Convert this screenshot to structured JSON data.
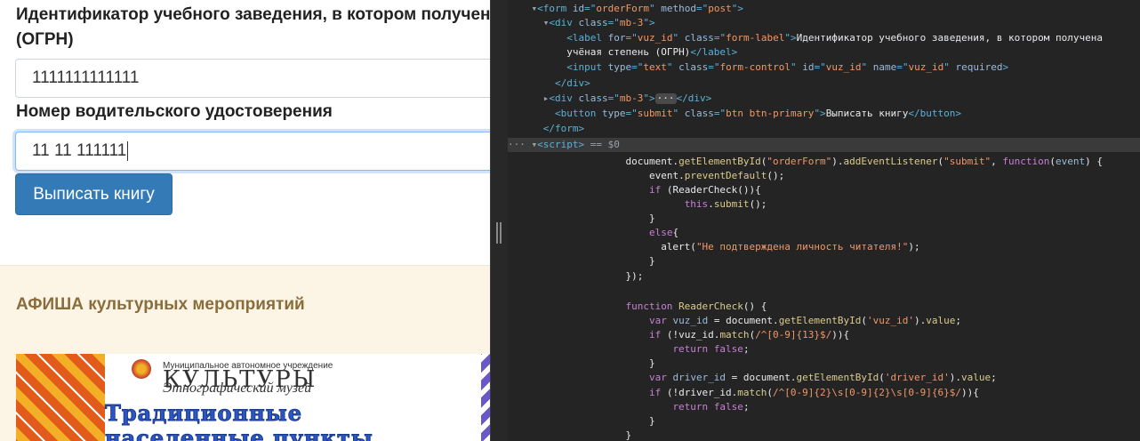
{
  "page": {
    "label_vuz": "Идентификатор учебного заведения, в котором получена учёная степень",
    "label_vuz_suffix": "(ОГРН)",
    "input_vuz_value": "1111111111111",
    "label_driver": "Номер водительского удостоверения",
    "input_driver_value": "11 11 111111",
    "submit_label": "Выписать книгу",
    "afisha_title": "АФИША культурных мероприятий",
    "poster": {
      "small": "Муниципальное автономное учреждение",
      "big": "КУЛЬТУРЫ",
      "italic": "Этнографический музей",
      "head1": "Традиционные",
      "head2": "населенные пункты"
    }
  },
  "devtools": {
    "lines": [
      {
        "html": "    <span class='tri'>▾</span><span class='tag'>&lt;form</span> <span class='an'>id</span><span class='tag'>=\"</span><span class='av'>orderForm</span><span class='tag'>\"</span> <span class='an'>method</span><span class='tag'>=\"</span><span class='av'>post</span><span class='tag'>\"&gt;</span>"
      },
      {
        "html": "      <span class='tri'>▾</span><span class='tag'>&lt;div</span> <span class='an'>class</span><span class='tag'>=\"</span><span class='av'>mb-3</span><span class='tag'>\"&gt;</span>"
      },
      {
        "html": "          <span class='tag'>&lt;label</span> <span class='an'>for</span><span class='tag'>=\"</span><span class='av'>vuz_id</span><span class='tag'>\"</span> <span class='an'>class</span><span class='tag'>=\"</span><span class='av'>form-label</span><span class='tag'>\"&gt;</span><span class='tx'>Идентификатор учебного заведения, в котором получена</span>"
      },
      {
        "html": "          <span class='tx'>учёная степень (ОГРН)</span><span class='tag'>&lt;/label&gt;</span>"
      },
      {
        "html": "          <span class='tag'>&lt;input</span> <span class='an'>type</span><span class='tag'>=\"</span><span class='av'>text</span><span class='tag'>\"</span> <span class='an'>class</span><span class='tag'>=\"</span><span class='av'>form-control</span><span class='tag'>\"</span> <span class='an'>id</span><span class='tag'>=\"</span><span class='av'>vuz_id</span><span class='tag'>\"</span> <span class='an'>name</span><span class='tag'>=\"</span><span class='av'>vuz_id</span><span class='tag'>\"</span> <span class='an'>required</span><span class='tag'>&gt;</span>"
      },
      {
        "html": "        <span class='tag'>&lt;/div&gt;</span>"
      },
      {
        "html": "      <span class='tri'>▸</span><span class='tag'>&lt;div</span> <span class='an'>class</span><span class='tag'>=\"</span><span class='av'>mb-3</span><span class='tag'>\"&gt;</span><span class='ell'>···</span><span class='tag'>&lt;/div&gt;</span>"
      },
      {
        "html": "        <span class='tag'>&lt;button</span> <span class='an'>type</span><span class='tag'>=\"</span><span class='av'>submit</span><span class='tag'>\"</span> <span class='an'>class</span><span class='tag'>=\"</span><span class='av'>btn btn-primary</span><span class='tag'>\"&gt;</span><span class='tx'>Выписать книгу</span><span class='tag'>&lt;/button&gt;</span>"
      },
      {
        "html": "      <span class='tag'>&lt;/form&gt;</span>"
      },
      {
        "html": "<span class='dim'>···</span> <span class='tri'>▾</span><span class='tag'>&lt;script&gt;</span> <span class='dim'>== </span><span class='dim'>$0</span>"
      },
      {
        "html": "                    <span class='pl'>document.</span><span class='mth'>getElementById</span><span class='pl'>(</span><span class='str'>\"orderForm\"</span><span class='pl'>).</span><span class='mth'>addEventListener</span><span class='pl'>(</span><span class='str'>\"submit\"</span><span class='pl'>, </span><span class='kw'>function</span><span class='pl'>(</span><span class='va'>event</span><span class='pl'>) {</span>"
      },
      {
        "html": "                        <span class='pl'>event.</span><span class='mth'>preventDefault</span><span class='pl'>();</span>"
      },
      {
        "html": "                        <span class='kw'>if</span><span class='pl'> (ReaderCheck()){</span>"
      },
      {
        "html": "                              <span class='kw'>this</span><span class='pl'>.</span><span class='mth'>submit</span><span class='pl'>();</span>"
      },
      {
        "html": "                        <span class='pl'>}</span>"
      },
      {
        "html": "                        <span class='kw'>else</span><span class='pl'>{</span>"
      },
      {
        "html": "                          <span class='pl'>alert(</span><span class='str'>\"Не подтверждена личность читателя!\"</span><span class='pl'>);</span>"
      },
      {
        "html": "                        <span class='pl'>}</span>"
      },
      {
        "html": "                    <span class='pl'>});</span>"
      },
      {
        "html": ""
      },
      {
        "html": "                    <span class='kw'>function</span> <span class='mth'>ReaderCheck</span><span class='pl'>() {</span>"
      },
      {
        "html": "                        <span class='kw'>var</span> <span class='va'>vuz_id</span><span class='pl'> = document.</span><span class='mth'>getElementById</span><span class='pl'>(</span><span class='str'>'vuz_id'</span><span class='pl'>).</span><span class='mth'>value</span><span class='pl'>;</span>"
      },
      {
        "html": "                        <span class='kw'>if</span><span class='pl'> (!vuz_id.</span><span class='mth'>match</span><span class='pl'>(</span><span class='rx'>/^[0-9]{13}$/</span><span class='pl'>)){</span>"
      },
      {
        "html": "                            <span class='kw'>return</span> <span class='kw'>false</span><span class='pl'>;</span>"
      },
      {
        "html": "                        <span class='pl'>}</span>"
      },
      {
        "html": "                        <span class='kw'>var</span> <span class='va'>driver_id</span><span class='pl'> = document.</span><span class='mth'>getElementById</span><span class='pl'>(</span><span class='str'>'driver_id'</span><span class='pl'>).</span><span class='mth'>value</span><span class='pl'>;</span>"
      },
      {
        "html": "                        <span class='kw'>if</span><span class='pl'> (!driver_id.</span><span class='mth'>match</span><span class='pl'>(</span><span class='rx'>/^[0-9]{2}\\s[0-9]{2}\\s[0-9]{6}$/</span><span class='pl'>)){</span>"
      },
      {
        "html": "                            <span class='kw'>return</span> <span class='kw'>false</span><span class='pl'>;</span>"
      },
      {
        "html": "                        <span class='pl'>}</span>"
      },
      {
        "html": "                    <span class='pl'>}</span>"
      }
    ]
  }
}
